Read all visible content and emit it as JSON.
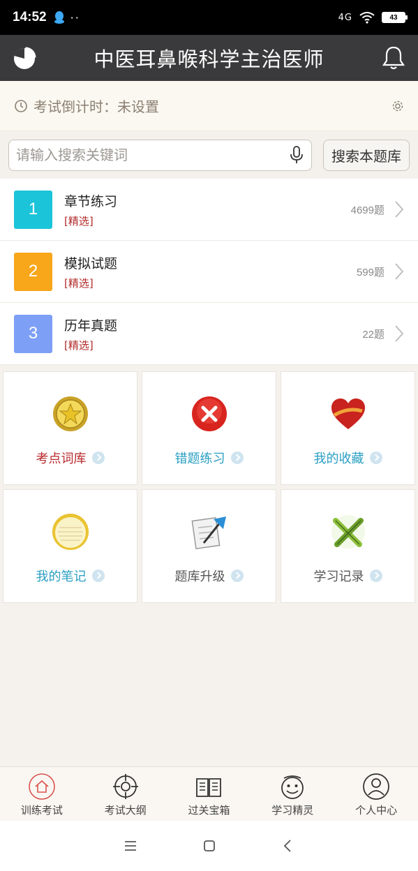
{
  "status_bar": {
    "time": "14:52",
    "dots": "··",
    "signal": "4G",
    "battery": "43"
  },
  "header": {
    "title": "中医耳鼻喉科学主治医师"
  },
  "countdown": {
    "label": "考试倒计时：未设置"
  },
  "search": {
    "placeholder": "请输入搜索关键词",
    "button_label": "搜索本题库"
  },
  "practice_list": [
    {
      "number": "1",
      "title": "章节练习",
      "tag": "[精选]",
      "count": "4699题",
      "color": "#1cc4d9"
    },
    {
      "number": "2",
      "title": "模拟试题",
      "tag": "[精选]",
      "count": "599题",
      "color": "#f8a61a"
    },
    {
      "number": "3",
      "title": "历年真题",
      "tag": "[精选]",
      "count": "22题",
      "color": "#7e9ff6"
    }
  ],
  "tiles": [
    {
      "label": "考点词库",
      "icon": "star-badge-icon",
      "color": "#b8282b"
    },
    {
      "label": "错题练习",
      "icon": "red-x-icon",
      "color": "#2a9fc2"
    },
    {
      "label": "我的收藏",
      "icon": "heart-icon",
      "color": "#2a9fc2"
    },
    {
      "label": "我的笔记",
      "icon": "notepad-icon",
      "color": "#2a9fc2"
    },
    {
      "label": "题库升级",
      "icon": "upgrade-icon",
      "color": "#555555"
    },
    {
      "label": "学习记录",
      "icon": "pencils-icon",
      "color": "#555555"
    }
  ],
  "tabs": [
    {
      "label": "训练考试",
      "icon": "home-icon",
      "active": true
    },
    {
      "label": "考试大纲",
      "icon": "target-icon",
      "active": false
    },
    {
      "label": "过关宝箱",
      "icon": "book-icon",
      "active": false
    },
    {
      "label": "学习精灵",
      "icon": "smiley-icon",
      "active": false
    },
    {
      "label": "个人中心",
      "icon": "person-icon",
      "active": false
    }
  ],
  "colors": {
    "header_bg": "#3a3a3c",
    "active_tab": "#d9534f",
    "tag_red": "#b22a2a"
  }
}
